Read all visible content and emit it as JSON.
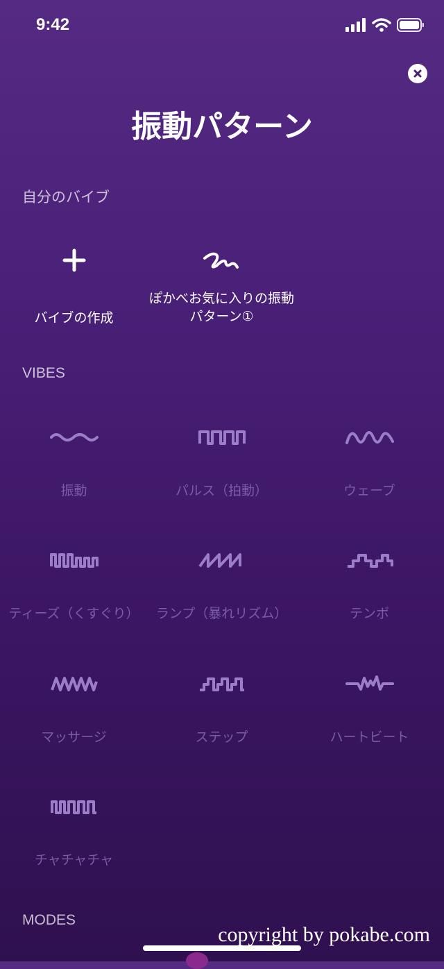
{
  "status_bar": {
    "time": "9:42"
  },
  "header": {
    "title": "振動パターン"
  },
  "mine": {
    "label": "自分のバイブ",
    "items": [
      {
        "label": "バイブの作成",
        "icon": "plus-icon"
      },
      {
        "label": "ぽかべお気に入りの振動パターン①",
        "icon": "squiggle-icon"
      }
    ]
  },
  "vibes": {
    "label": "VIBES",
    "items": [
      {
        "label": "振動",
        "icon": "wave-small-icon"
      },
      {
        "label": "パルス（拍動）",
        "icon": "pulse-icon"
      },
      {
        "label": "ウェーブ",
        "icon": "wave-icon"
      },
      {
        "label": "ティーズ（くすぐり）",
        "icon": "tease-icon"
      },
      {
        "label": "ランプ（暴れリズム）",
        "icon": "ramp-icon"
      },
      {
        "label": "テンポ",
        "icon": "tempo-icon"
      },
      {
        "label": "マッサージ",
        "icon": "massage-icon"
      },
      {
        "label": "ステップ",
        "icon": "step-icon"
      },
      {
        "label": "ハートビート",
        "icon": "heartbeat-icon"
      },
      {
        "label": "チャチャチャ",
        "icon": "chachacha-icon"
      }
    ]
  },
  "modes": {
    "label": "MODES"
  },
  "watermark": "copyright by pokabe.com",
  "colors": {
    "background_top": "#552a82",
    "background_bottom": "#2f104f",
    "vibe_icon": "#9b7ec7",
    "vibe_label": "#7b5ba6"
  }
}
